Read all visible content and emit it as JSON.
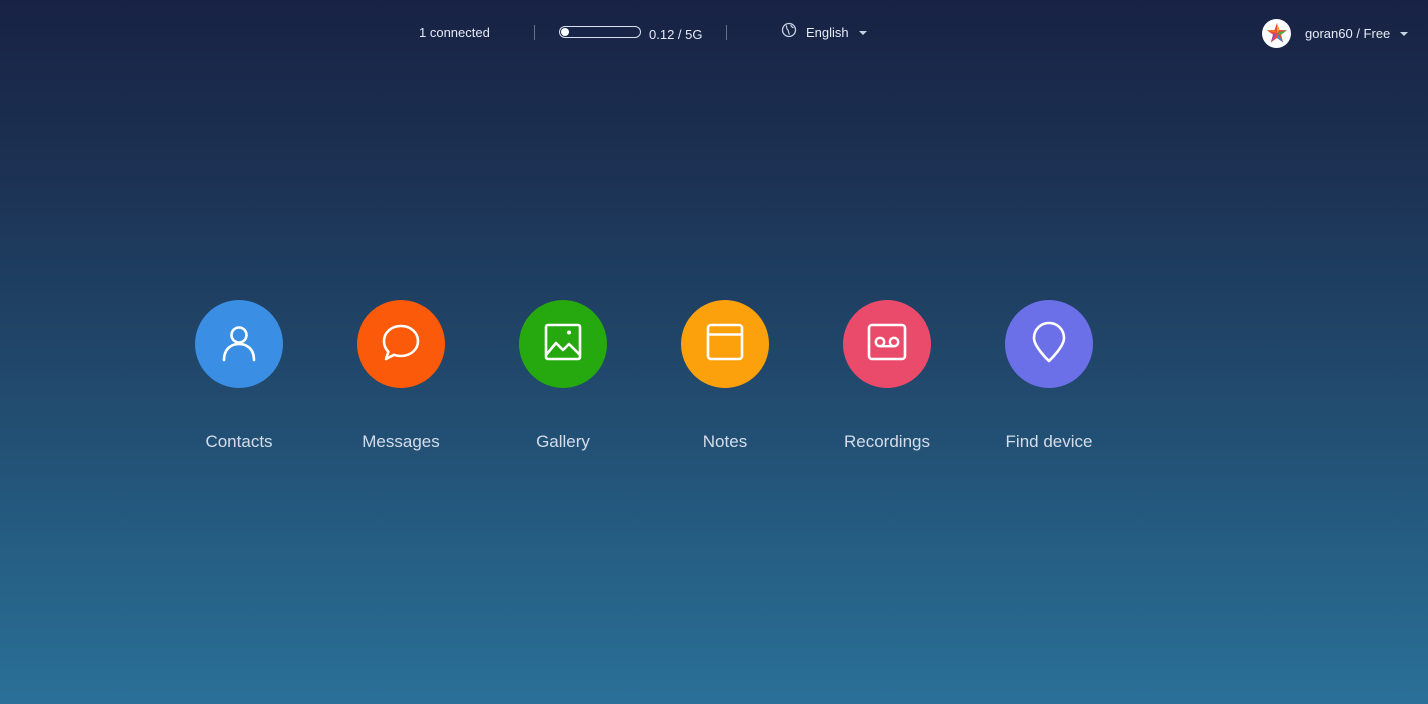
{
  "header": {
    "connected_text": "1 connected",
    "storage": {
      "text": "0.12 / 5G",
      "used_fraction": 0.024
    },
    "language": {
      "selected": "English",
      "icon": "globe-icon"
    },
    "user": {
      "label": "goran60 / Free",
      "avatar_icon": "star-avatar-icon"
    }
  },
  "apps": [
    {
      "label": "Contacts",
      "icon": "person-icon",
      "color": "#3a8fe4"
    },
    {
      "label": "Messages",
      "icon": "chat-bubble-icon",
      "color": "#fb5a0a"
    },
    {
      "label": "Gallery",
      "icon": "image-icon",
      "color": "#26a80f"
    },
    {
      "label": "Notes",
      "icon": "notes-icon",
      "color": "#fca10c"
    },
    {
      "label": "Recordings",
      "icon": "recorder-icon",
      "color": "#eb4b6b"
    },
    {
      "label": "Find device",
      "icon": "location-pin-icon",
      "color": "#6b70e9"
    }
  ],
  "colors": {
    "bg_top": "#182244",
    "bg_bottom": "#2a7098",
    "text": "#e6ebf5"
  }
}
